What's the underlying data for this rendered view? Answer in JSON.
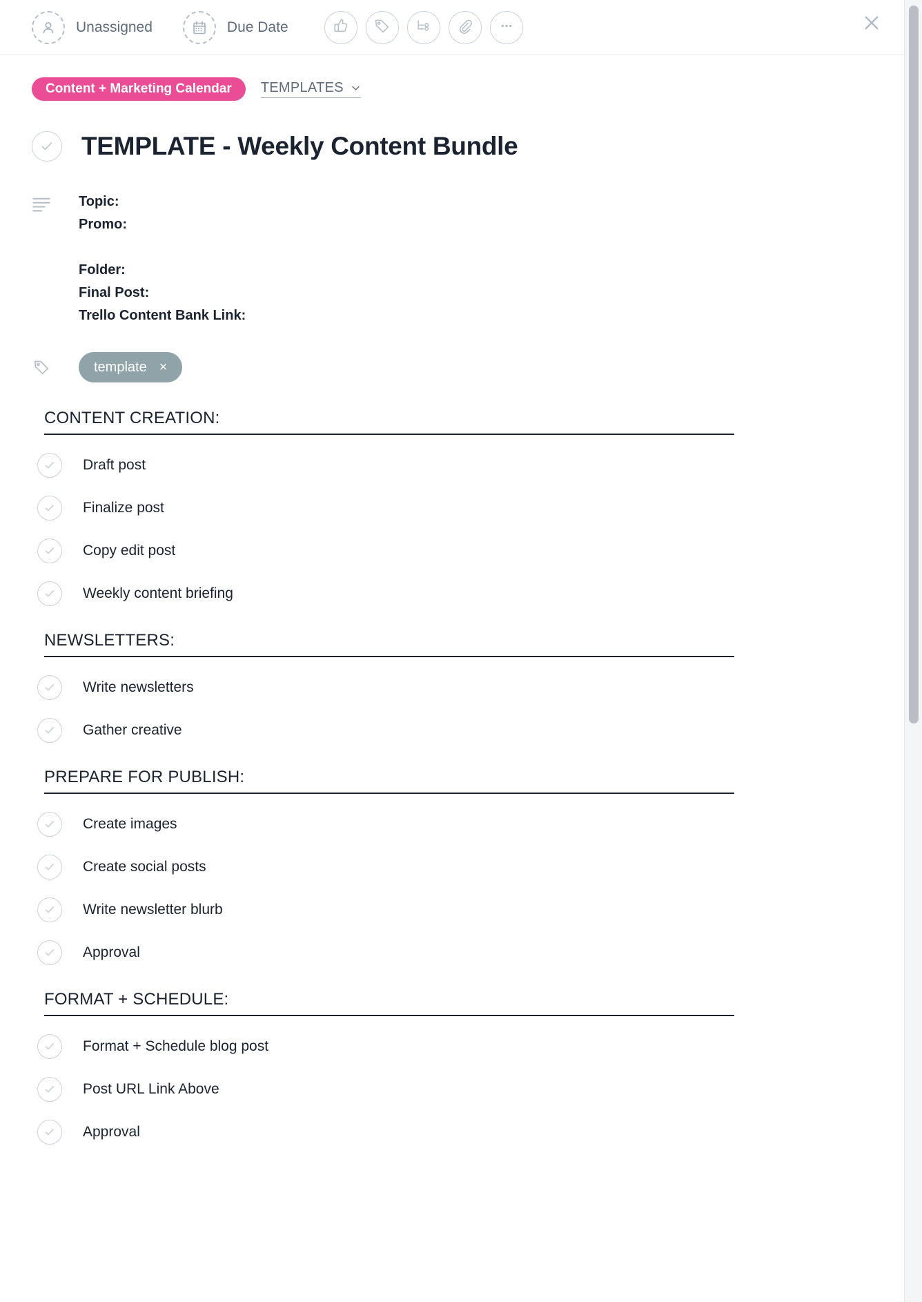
{
  "toolbar": {
    "assignee_label": "Unassigned",
    "assignee_icon": "user-outline-icon",
    "duedate_label": "Due Date",
    "duedate_icon": "calendar-icon",
    "actions": [
      {
        "name": "like-button",
        "icon": "thumbs-up-icon"
      },
      {
        "name": "tag-button",
        "icon": "tag-icon"
      },
      {
        "name": "subtask-button",
        "icon": "subtask-branch-icon"
      },
      {
        "name": "attach-button",
        "icon": "paperclip-icon"
      },
      {
        "name": "more-button",
        "icon": "ellipsis-icon"
      }
    ],
    "close_icon": "close-icon"
  },
  "breadcrumb": {
    "board_name": "Content + Marketing Calendar",
    "board_color": "#ea4c96",
    "list_name": "TEMPLATES",
    "list_chevron_icon": "chevron-down-icon"
  },
  "card": {
    "complete_icon": "circle-check-icon",
    "title": "TEMPLATE - Weekly Content Bundle"
  },
  "description": {
    "icon": "description-lines-icon",
    "lines": [
      "Topic:",
      "Promo:",
      "",
      "Folder:",
      "Final Post:",
      "Trello Content Bank Link:"
    ]
  },
  "tags": {
    "icon": "tag-icon",
    "items": [
      {
        "label": "template",
        "color": "#8fa3a9",
        "remove_icon": "close-icon",
        "remove_label": "×"
      }
    ]
  },
  "checklists": [
    {
      "title": "CONTENT CREATION:",
      "items": [
        "Draft post",
        "Finalize post",
        "Copy edit post",
        "Weekly content briefing"
      ]
    },
    {
      "title": "NEWSLETTERS:",
      "items": [
        "Write newsletters",
        "Gather creative"
      ]
    },
    {
      "title": "PREPARE FOR PUBLISH:",
      "items": [
        "Create images",
        "Create social posts",
        "Write newsletter blurb",
        "Approval"
      ]
    },
    {
      "title": "FORMAT + SCHEDULE:",
      "items": [
        "Format + Schedule blog post",
        "Post URL Link Above",
        "Approval"
      ]
    }
  ],
  "scrollbar": {
    "name": "vertical-scrollbar"
  }
}
